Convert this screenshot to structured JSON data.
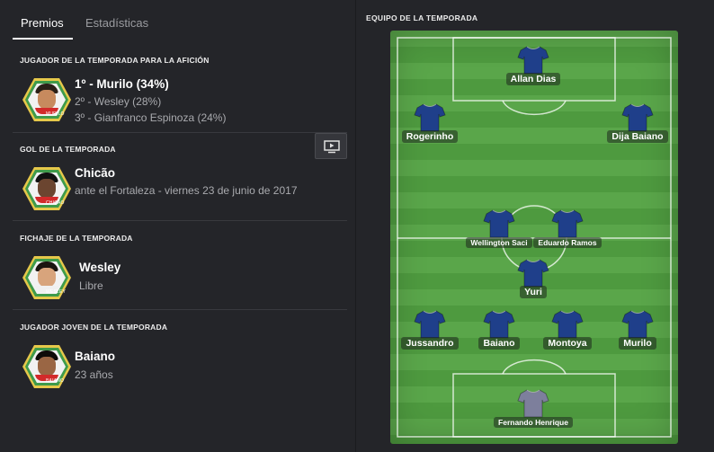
{
  "tabs": [
    {
      "label": "Premios",
      "active": true
    },
    {
      "label": "Estadísticas",
      "active": false
    }
  ],
  "awards": [
    {
      "title": "JUGADOR DE LA TEMPORADA PARA LA AFICIÓN",
      "main": "1º - Murilo (34%)",
      "lines": [
        "2º - Wesley (28%)",
        "3º - Gianfranco Espinoza (24%)"
      ],
      "badge_label": "MURILO"
    },
    {
      "title": "GOL DE LA TEMPORADA",
      "main": "Chicão",
      "lines": [
        "ante el Fortaleza - viernes 23 de junio de 2017"
      ],
      "badge_label": "CHICÃO",
      "action_icon": "play-video-icon"
    },
    {
      "title": "FICHAJE DE LA TEMPORADA",
      "main": "Wesley",
      "lines": [
        "Libre"
      ],
      "badge_label": "WESLEY"
    },
    {
      "title": "JUGADOR JOVEN DE LA TEMPORADA",
      "main": "Baiano",
      "lines": [
        "23 años"
      ],
      "badge_label": "BAIANO"
    }
  ],
  "team": {
    "title": "EQUIPO DE LA TEMPORADA",
    "players": [
      {
        "name": "Allan Dias",
        "role": "forward"
      },
      {
        "name": "Rogerinho",
        "role": "winger-left"
      },
      {
        "name": "Dija Baiano",
        "role": "winger-right"
      },
      {
        "name": "Wellington Saci",
        "role": "midfielder"
      },
      {
        "name": "Eduardo Ramos",
        "role": "midfielder"
      },
      {
        "name": "Yuri",
        "role": "defensive-midfielder"
      },
      {
        "name": "Jussandro",
        "role": "defender"
      },
      {
        "name": "Baiano",
        "role": "defender"
      },
      {
        "name": "Montoya",
        "role": "defender"
      },
      {
        "name": "Murilo",
        "role": "defender"
      },
      {
        "name": "Fernando Henrique",
        "role": "goalkeeper"
      }
    ]
  },
  "colors": {
    "background": "#242529",
    "pitch_light": "#5aa64a",
    "pitch_dark": "#4e9a3f",
    "kit": "#1f3f8a",
    "goalkeeper_kit": "#7d7f9c",
    "badge_green": "#3f9b4a",
    "badge_yellow": "#e6c84a"
  }
}
